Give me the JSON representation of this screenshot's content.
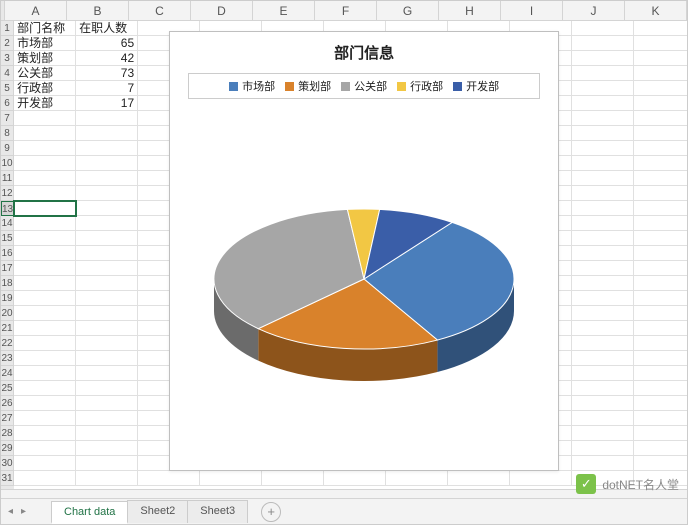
{
  "columns": [
    "A",
    "B",
    "C",
    "D",
    "E",
    "F",
    "G",
    "H",
    "I",
    "J",
    "K"
  ],
  "row_count": 31,
  "selected_row": 13,
  "header_row": {
    "a": "部门名称",
    "b": "在职人数"
  },
  "data_rows": [
    {
      "a": "市场部",
      "b": "65"
    },
    {
      "a": "策划部",
      "b": "42"
    },
    {
      "a": "公关部",
      "b": "73"
    },
    {
      "a": "行政部",
      "b": "7"
    },
    {
      "a": "开发部",
      "b": "17"
    }
  ],
  "chart_data": {
    "type": "pie",
    "title": "部门信息",
    "categories": [
      "市场部",
      "策划部",
      "公关部",
      "行政部",
      "开发部"
    ],
    "values": [
      65,
      42,
      73,
      7,
      17
    ],
    "colors": [
      "#4a7ebb",
      "#d9822b",
      "#a6a6a6",
      "#f2c744",
      "#3a5ea8"
    ]
  },
  "tabs": {
    "items": [
      "Chart data",
      "Sheet2",
      "Sheet3"
    ],
    "active": 0,
    "add_label": "+"
  },
  "watermark": {
    "text": "dotNET名人堂",
    "icon": "✓"
  },
  "nav": {
    "first": "◂",
    "prev": "◂",
    "next": "▸",
    "last": "▸"
  }
}
